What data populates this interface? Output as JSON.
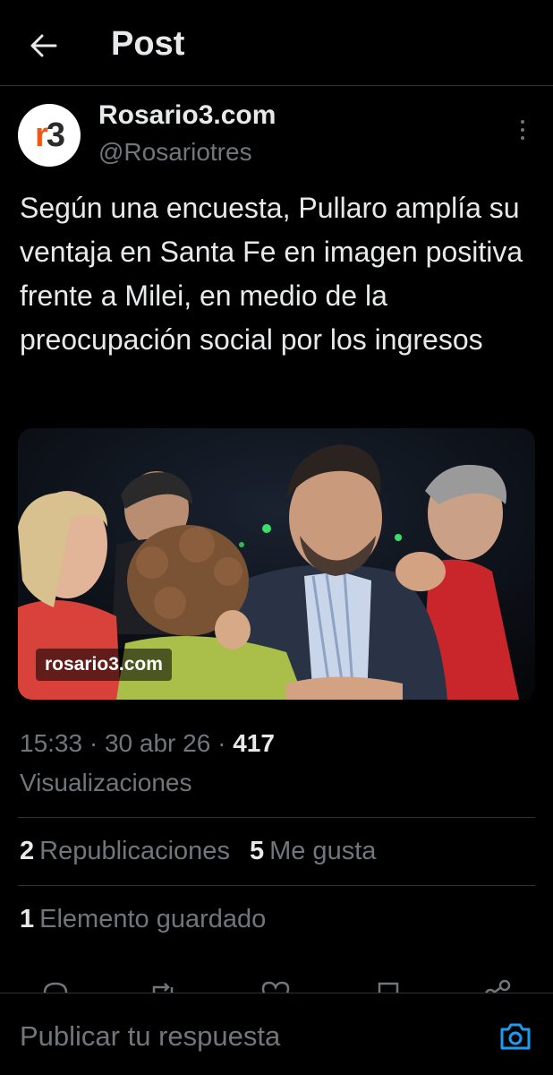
{
  "header": {
    "title": "Post"
  },
  "author": {
    "avatar_text_r": "r",
    "avatar_text_3": "3",
    "name": "Rosario3.com",
    "handle": "@Rosariotres"
  },
  "post": {
    "text": "Según una encuesta, Pullaro amplía su ventaja en Santa Fe en imagen positiva frente a Milei, en medio de la preocupación social por los ingresos",
    "image_watermark": "rosario3.com"
  },
  "meta": {
    "time": "15:33",
    "date": "30 abr 26",
    "views_count": "417",
    "views_label": "Visualizaciones"
  },
  "stats": {
    "reposts_count": "2",
    "reposts_label": "Republicaciones",
    "likes_count": "5",
    "likes_label": "Me gusta",
    "bookmarks_count": "1",
    "bookmarks_label": "Elemento guardado"
  },
  "reply": {
    "placeholder": "Publicar tu respuesta"
  },
  "colors": {
    "background": "#000000",
    "text": "#e7e9ea",
    "secondary": "#71767b",
    "accent": "#1d9bf0",
    "divider": "#2f3336"
  }
}
